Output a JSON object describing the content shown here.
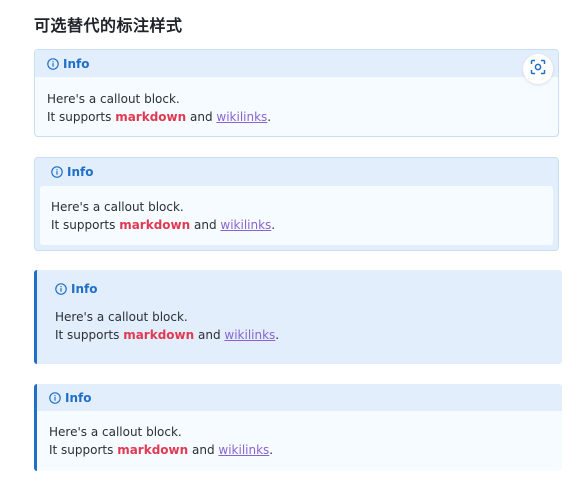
{
  "page": {
    "title": "可选替代的标注样式"
  },
  "colors": {
    "accent": "#1f6fc6",
    "header_bg": "#e3eefc",
    "body_bg": "#f6fbff",
    "markdown": "#e03a52",
    "wikilinks": "#8a63d2"
  },
  "callouts": [
    {
      "icon": "info-circle-icon",
      "title": "Info",
      "line1": "Here's a callout block.",
      "line2_pre": "It supports ",
      "line2_bold": "markdown",
      "line2_mid": " and ",
      "line2_link": "wikilinks",
      "line2_post": "."
    },
    {
      "icon": "info-circle-icon",
      "title": "Info",
      "line1": "Here's a callout block.",
      "line2_pre": "It supports ",
      "line2_bold": "markdown",
      "line2_mid": " and ",
      "line2_link": "wikilinks",
      "line2_post": "."
    },
    {
      "icon": "info-circle-icon",
      "title": "Info",
      "line1": "Here's a callout block.",
      "line2_pre": "It supports ",
      "line2_bold": "markdown",
      "line2_mid": " and ",
      "line2_link": "wikilinks",
      "line2_post": "."
    },
    {
      "icon": "info-circle-icon",
      "title": "Info",
      "line1": "Here's a callout block.",
      "line2_pre": "It supports ",
      "line2_bold": "markdown",
      "line2_mid": " and ",
      "line2_link": "wikilinks",
      "line2_post": "."
    }
  ],
  "floating_button": {
    "icon": "scan-icon"
  }
}
